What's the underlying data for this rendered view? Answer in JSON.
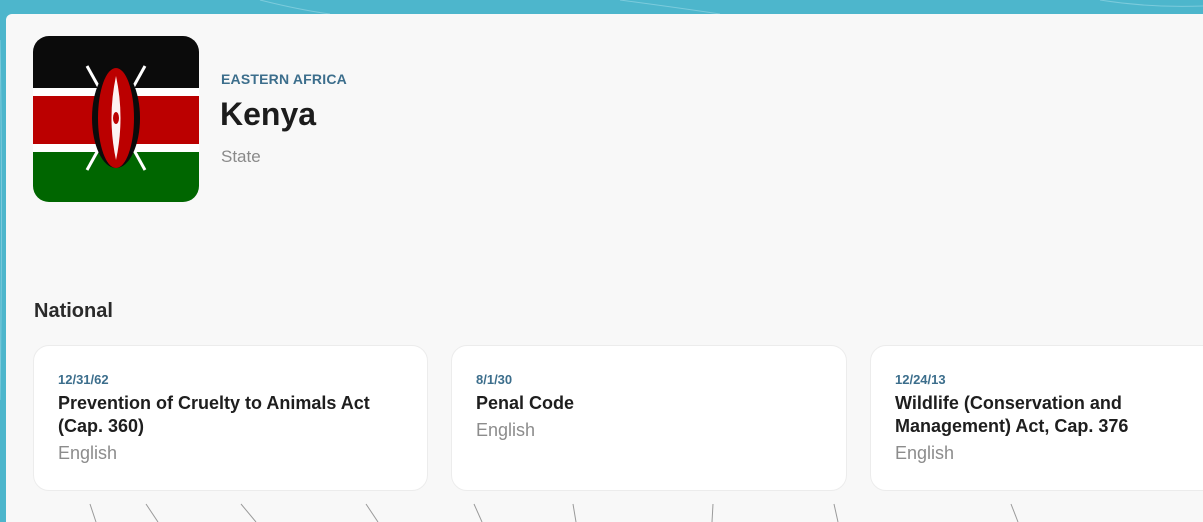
{
  "header": {
    "region": "EASTERN AFRICA",
    "country": "Kenya",
    "type": "State",
    "flag_icon": "kenya-flag-icon"
  },
  "section_title": "National",
  "laws": [
    {
      "date": "12/31/62",
      "title": "Prevention of Cruelty to Animals Act (Cap. 360)",
      "language": "English"
    },
    {
      "date": "8/1/30",
      "title": "Penal Code",
      "language": "English"
    },
    {
      "date": "12/24/13",
      "title": "Wildlife (Conservation and Management) Act, Cap. 376",
      "language": "English"
    }
  ],
  "colors": {
    "accent": "#3c6e8c",
    "background_frame": "#4db6cc",
    "panel": "#f8f8f8"
  }
}
